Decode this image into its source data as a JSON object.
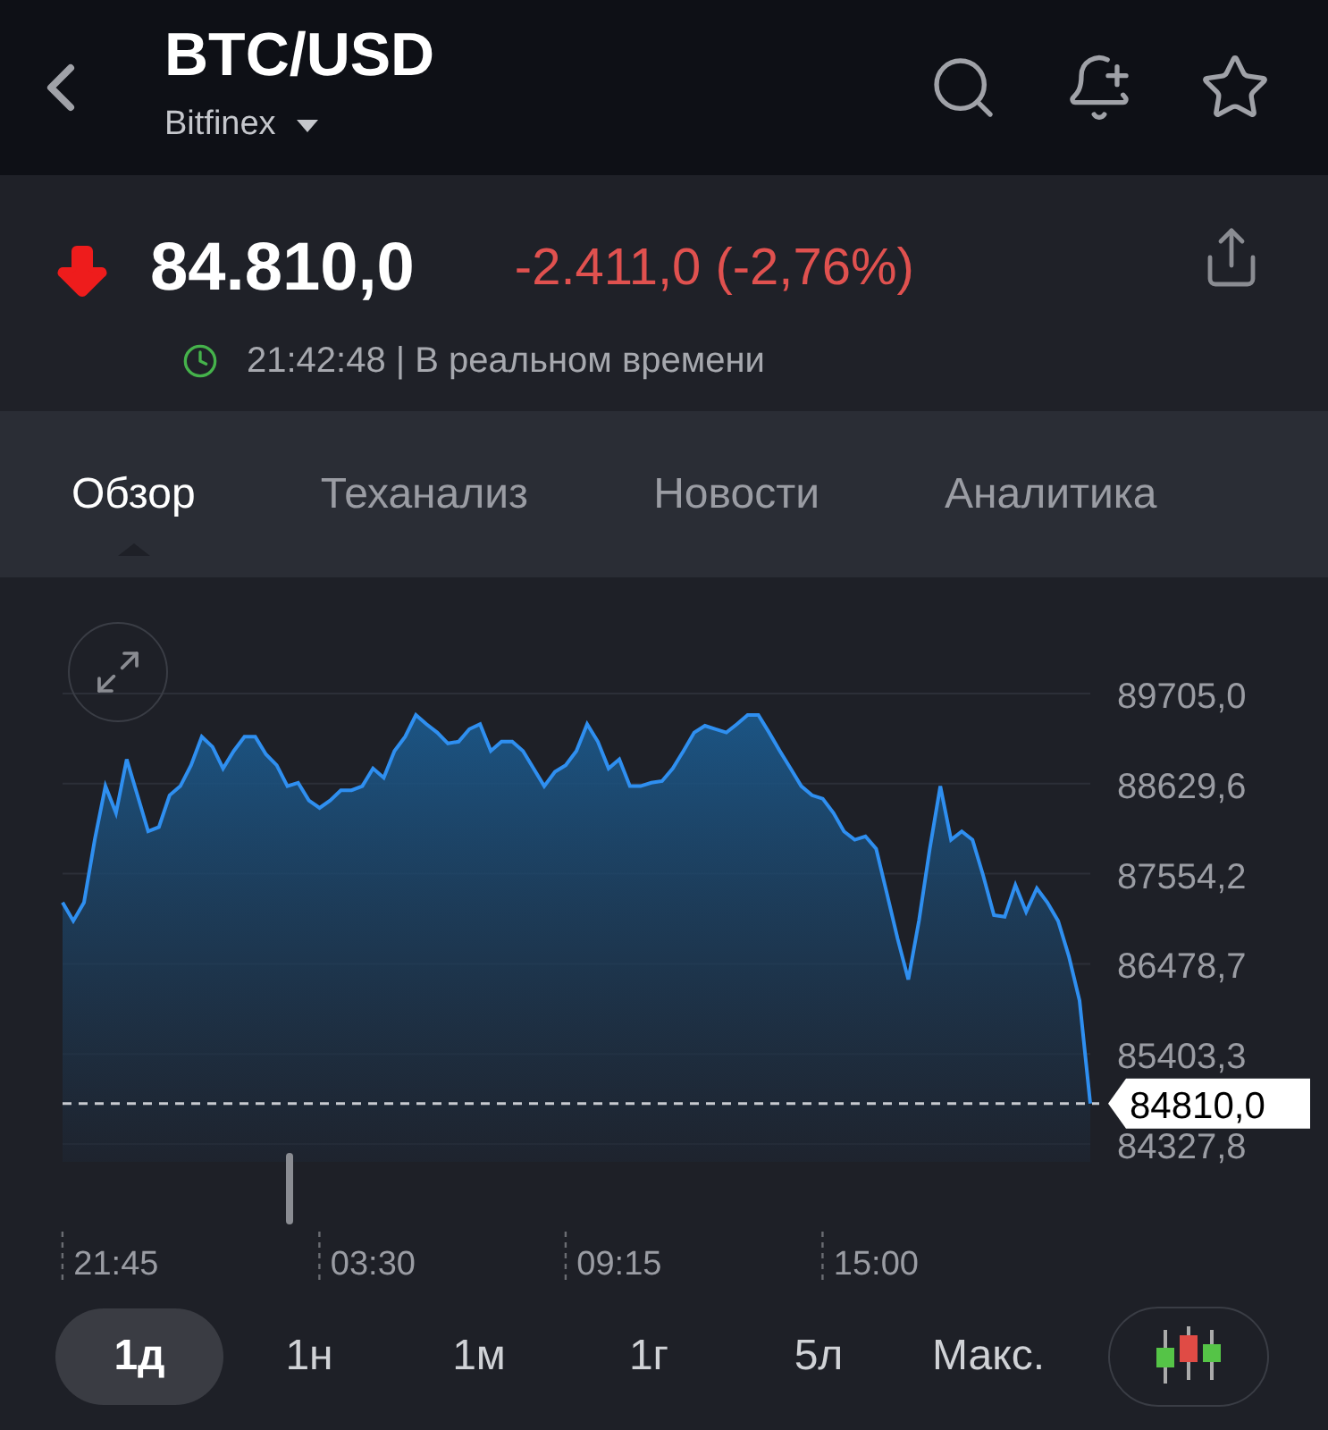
{
  "header": {
    "symbol": "BTC/USD",
    "exchange": "Bitfinex"
  },
  "quote": {
    "price": "84.810,0",
    "change": "-2.411,0 (-2,76%)",
    "time": "21:42:48 | В реальном времени"
  },
  "tabs": [
    {
      "label": "Обзор",
      "selected": true
    },
    {
      "label": "Теханализ",
      "selected": false
    },
    {
      "label": "Новости",
      "selected": false
    },
    {
      "label": "Аналитика",
      "selected": false
    }
  ],
  "chart": {
    "chart_data": {
      "type": "area",
      "grid": true,
      "ylim": [
        84327.8,
        89705.0
      ],
      "categories": [
        null,
        null,
        null,
        null,
        null,
        "21:45",
        null,
        null,
        null,
        null,
        null,
        null,
        null,
        null,
        null,
        null,
        null,
        null,
        null,
        null,
        null,
        null,
        null,
        null,
        null,
        null,
        null,
        null,
        null,
        "03:30",
        null,
        null,
        null,
        null,
        null,
        null,
        null,
        null,
        null,
        null,
        null,
        null,
        null,
        null,
        null,
        null,
        null,
        null,
        null,
        null,
        null,
        null,
        "09:15",
        null,
        null,
        null,
        null,
        null,
        null,
        null,
        null,
        null,
        null,
        null,
        null,
        null,
        null,
        null,
        null,
        null,
        null,
        null,
        null,
        null,
        null,
        null,
        "15:00",
        null,
        null,
        null,
        null,
        null,
        null,
        null,
        null,
        null,
        null,
        null,
        null,
        null,
        null,
        null,
        null,
        null,
        null,
        null,
        null
      ],
      "yticks": [
        {
          "value": 89705.0,
          "label": "89705,0"
        },
        {
          "value": 88629.6,
          "label": "88629,6"
        },
        {
          "value": 87554.2,
          "label": "87554,2"
        },
        {
          "value": 86478.7,
          "label": "86478,7"
        },
        {
          "value": 85403.3,
          "label": "85403,3"
        },
        {
          "value": 84327.8,
          "label": "84327,8"
        }
      ],
      "series": [
        {
          "color": "#2f8ff0",
          "values": [
            87210,
            86990,
            87210,
            87960,
            88600,
            88280,
            88920,
            88490,
            88060,
            88110,
            88490,
            88600,
            88850,
            89190,
            89070,
            88810,
            89020,
            89190,
            89190,
            88980,
            88850,
            88600,
            88640,
            88430,
            88340,
            88430,
            88550,
            88550,
            88600,
            88810,
            88700,
            89020,
            89190,
            89450,
            89340,
            89240,
            89110,
            89130,
            89280,
            89340,
            89020,
            89130,
            89130,
            89020,
            88810,
            88600,
            88770,
            88850,
            89020,
            89340,
            89130,
            88810,
            88920,
            88600,
            88600,
            88640,
            88660,
            88810,
            89020,
            89240,
            89320,
            89280,
            89240,
            89340,
            89450,
            89450,
            89240,
            89020,
            88810,
            88600,
            88490,
            88450,
            88280,
            88060,
            87960,
            88000,
            87850,
            87320,
            86780,
            86290,
            87000,
            87850,
            88600,
            87960,
            88060,
            87960,
            87530,
            87060,
            87040,
            87420,
            87100,
            87380,
            87210,
            86990,
            86570,
            86040,
            84810
          ]
        }
      ],
      "ref_lines": [
        {
          "axis": "y",
          "value": 84810.0,
          "label": "84810,0"
        }
      ]
    }
  },
  "ranges": [
    {
      "label": "1д",
      "selected": true
    },
    {
      "label": "1н",
      "selected": false
    },
    {
      "label": "1м",
      "selected": false
    },
    {
      "label": "1г",
      "selected": false
    },
    {
      "label": "5л",
      "selected": false
    },
    {
      "label": "Макс.",
      "selected": false
    }
  ]
}
